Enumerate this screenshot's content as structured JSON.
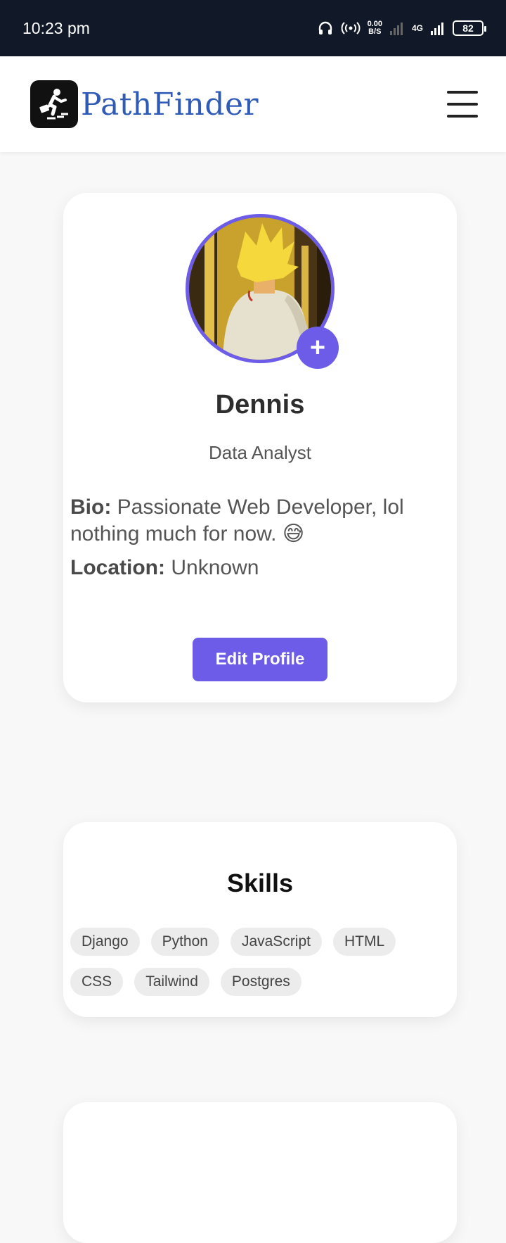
{
  "status_bar": {
    "time": "10:23 pm",
    "net_speed_value": "0.00",
    "net_speed_unit": "B/S",
    "network_type": "4G",
    "battery": "82"
  },
  "header": {
    "brand_name": "PathFinder",
    "logo_icon": "person-running-stairs-icon",
    "menu_icon": "hamburger-menu-icon",
    "brand_color": "#2f5bb7"
  },
  "profile": {
    "name": "Dennis",
    "role": "Data Analyst",
    "bio_label": "Bio:",
    "bio_text": "Passionate Web Developer, lol nothing much for now. 😅",
    "location_label": "Location:",
    "location_text": "Unknown",
    "edit_button_label": "Edit Profile",
    "add_photo_label": "+",
    "accent_color": "#6c5ce7"
  },
  "skills": {
    "title": "Skills",
    "items": [
      "Django",
      "Python",
      "JavaScript",
      "HTML",
      "CSS",
      "Tailwind",
      "Postgres"
    ]
  }
}
